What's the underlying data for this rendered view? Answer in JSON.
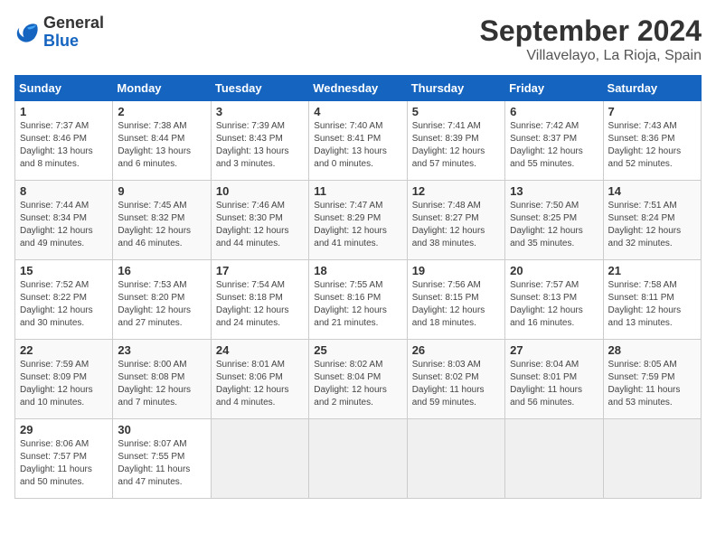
{
  "header": {
    "logo_general": "General",
    "logo_blue": "Blue",
    "title": "September 2024",
    "subtitle": "Villavelayo, La Rioja, Spain"
  },
  "columns": [
    "Sunday",
    "Monday",
    "Tuesday",
    "Wednesday",
    "Thursday",
    "Friday",
    "Saturday"
  ],
  "weeks": [
    [
      {
        "day": "1",
        "sunrise": "7:37 AM",
        "sunset": "8:46 PM",
        "daylight": "13 hours and 8 minutes."
      },
      {
        "day": "2",
        "sunrise": "7:38 AM",
        "sunset": "8:44 PM",
        "daylight": "13 hours and 6 minutes."
      },
      {
        "day": "3",
        "sunrise": "7:39 AM",
        "sunset": "8:43 PM",
        "daylight": "13 hours and 3 minutes."
      },
      {
        "day": "4",
        "sunrise": "7:40 AM",
        "sunset": "8:41 PM",
        "daylight": "13 hours and 0 minutes."
      },
      {
        "day": "5",
        "sunrise": "7:41 AM",
        "sunset": "8:39 PM",
        "daylight": "12 hours and 57 minutes."
      },
      {
        "day": "6",
        "sunrise": "7:42 AM",
        "sunset": "8:37 PM",
        "daylight": "12 hours and 55 minutes."
      },
      {
        "day": "7",
        "sunrise": "7:43 AM",
        "sunset": "8:36 PM",
        "daylight": "12 hours and 52 minutes."
      }
    ],
    [
      {
        "day": "8",
        "sunrise": "7:44 AM",
        "sunset": "8:34 PM",
        "daylight": "12 hours and 49 minutes."
      },
      {
        "day": "9",
        "sunrise": "7:45 AM",
        "sunset": "8:32 PM",
        "daylight": "12 hours and 46 minutes."
      },
      {
        "day": "10",
        "sunrise": "7:46 AM",
        "sunset": "8:30 PM",
        "daylight": "12 hours and 44 minutes."
      },
      {
        "day": "11",
        "sunrise": "7:47 AM",
        "sunset": "8:29 PM",
        "daylight": "12 hours and 41 minutes."
      },
      {
        "day": "12",
        "sunrise": "7:48 AM",
        "sunset": "8:27 PM",
        "daylight": "12 hours and 38 minutes."
      },
      {
        "day": "13",
        "sunrise": "7:50 AM",
        "sunset": "8:25 PM",
        "daylight": "12 hours and 35 minutes."
      },
      {
        "day": "14",
        "sunrise": "7:51 AM",
        "sunset": "8:24 PM",
        "daylight": "12 hours and 32 minutes."
      }
    ],
    [
      {
        "day": "15",
        "sunrise": "7:52 AM",
        "sunset": "8:22 PM",
        "daylight": "12 hours and 30 minutes."
      },
      {
        "day": "16",
        "sunrise": "7:53 AM",
        "sunset": "8:20 PM",
        "daylight": "12 hours and 27 minutes."
      },
      {
        "day": "17",
        "sunrise": "7:54 AM",
        "sunset": "8:18 PM",
        "daylight": "12 hours and 24 minutes."
      },
      {
        "day": "18",
        "sunrise": "7:55 AM",
        "sunset": "8:16 PM",
        "daylight": "12 hours and 21 minutes."
      },
      {
        "day": "19",
        "sunrise": "7:56 AM",
        "sunset": "8:15 PM",
        "daylight": "12 hours and 18 minutes."
      },
      {
        "day": "20",
        "sunrise": "7:57 AM",
        "sunset": "8:13 PM",
        "daylight": "12 hours and 16 minutes."
      },
      {
        "day": "21",
        "sunrise": "7:58 AM",
        "sunset": "8:11 PM",
        "daylight": "12 hours and 13 minutes."
      }
    ],
    [
      {
        "day": "22",
        "sunrise": "7:59 AM",
        "sunset": "8:09 PM",
        "daylight": "12 hours and 10 minutes."
      },
      {
        "day": "23",
        "sunrise": "8:00 AM",
        "sunset": "8:08 PM",
        "daylight": "12 hours and 7 minutes."
      },
      {
        "day": "24",
        "sunrise": "8:01 AM",
        "sunset": "8:06 PM",
        "daylight": "12 hours and 4 minutes."
      },
      {
        "day": "25",
        "sunrise": "8:02 AM",
        "sunset": "8:04 PM",
        "daylight": "12 hours and 2 minutes."
      },
      {
        "day": "26",
        "sunrise": "8:03 AM",
        "sunset": "8:02 PM",
        "daylight": "11 hours and 59 minutes."
      },
      {
        "day": "27",
        "sunrise": "8:04 AM",
        "sunset": "8:01 PM",
        "daylight": "11 hours and 56 minutes."
      },
      {
        "day": "28",
        "sunrise": "8:05 AM",
        "sunset": "7:59 PM",
        "daylight": "11 hours and 53 minutes."
      }
    ],
    [
      {
        "day": "29",
        "sunrise": "8:06 AM",
        "sunset": "7:57 PM",
        "daylight": "11 hours and 50 minutes."
      },
      {
        "day": "30",
        "sunrise": "8:07 AM",
        "sunset": "7:55 PM",
        "daylight": "11 hours and 47 minutes."
      },
      null,
      null,
      null,
      null,
      null
    ]
  ],
  "labels": {
    "sunrise": "Sunrise:",
    "sunset": "Sunset:",
    "daylight": "Daylight:"
  }
}
